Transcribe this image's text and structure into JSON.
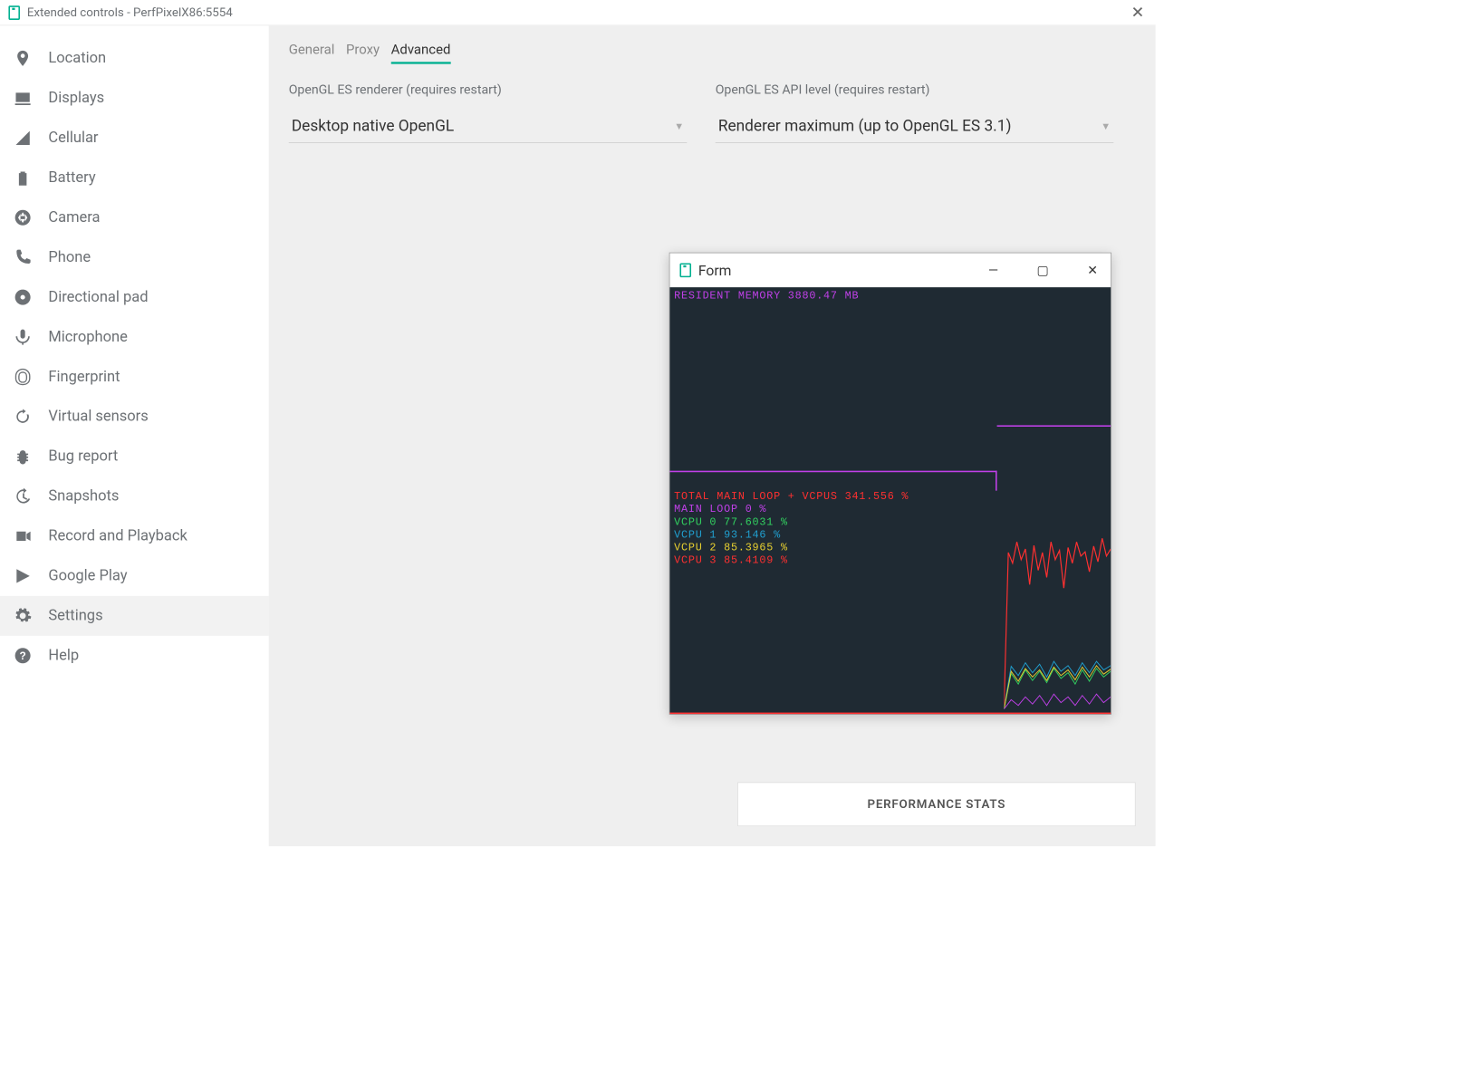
{
  "window": {
    "title": "Extended controls - PerfPixelX86:5554"
  },
  "sidebar": {
    "items": [
      {
        "id": "location",
        "label": "Location",
        "icon": "pin"
      },
      {
        "id": "displays",
        "label": "Displays",
        "icon": "display"
      },
      {
        "id": "cellular",
        "label": "Cellular",
        "icon": "signal"
      },
      {
        "id": "battery",
        "label": "Battery",
        "icon": "battery"
      },
      {
        "id": "camera",
        "label": "Camera",
        "icon": "aperture"
      },
      {
        "id": "phone",
        "label": "Phone",
        "icon": "phone"
      },
      {
        "id": "dpad",
        "label": "Directional pad",
        "icon": "dpad"
      },
      {
        "id": "microphone",
        "label": "Microphone",
        "icon": "mic"
      },
      {
        "id": "fingerprint",
        "label": "Fingerprint",
        "icon": "fingerprint"
      },
      {
        "id": "sensors",
        "label": "Virtual sensors",
        "icon": "rotate"
      },
      {
        "id": "bugreport",
        "label": "Bug report",
        "icon": "bug"
      },
      {
        "id": "snapshots",
        "label": "Snapshots",
        "icon": "history"
      },
      {
        "id": "record",
        "label": "Record and Playback",
        "icon": "video"
      },
      {
        "id": "play",
        "label": "Google Play",
        "icon": "play"
      },
      {
        "id": "settings",
        "label": "Settings",
        "icon": "gear",
        "active": true
      },
      {
        "id": "help",
        "label": "Help",
        "icon": "help"
      }
    ]
  },
  "tabs": {
    "items": [
      {
        "id": "general",
        "label": "General",
        "active": false
      },
      {
        "id": "proxy",
        "label": "Proxy",
        "active": false
      },
      {
        "id": "advanced",
        "label": "Advanced",
        "active": true
      }
    ]
  },
  "settings": {
    "renderer": {
      "label": "OpenGL ES renderer (requires restart)",
      "value": "Desktop native OpenGL"
    },
    "api_level": {
      "label": "OpenGL ES API level (requires restart)",
      "value": "Renderer maximum (up to OpenGL ES 3.1)"
    }
  },
  "perf_button": "PERFORMANCE STATS",
  "form": {
    "title": "Form",
    "memory": {
      "text": "RESIDENT MEMORY 3880.47 MB"
    },
    "cpu": {
      "total": "TOTAL MAIN LOOP + VCPUS 341.556 %",
      "mainloop": "MAIN LOOP 0 %",
      "v0": "VCPU 0 77.6031 %",
      "v1": "VCPU 1 93.146 %",
      "v2": "VCPU 2 85.3965 %",
      "v3": "VCPU 3 85.4109 %"
    }
  },
  "chart_data": [
    {
      "type": "line",
      "title": "Resident Memory",
      "ylabel": "MB",
      "current": 3880.47,
      "note": "stepped; only the live trace is visible (step up near right edge)"
    },
    {
      "type": "line",
      "title": "CPU Utilization",
      "ylabel": "%",
      "series": [
        {
          "name": "TOTAL MAIN LOOP + VCPUS",
          "current": 341.556,
          "color": "#ff3030"
        },
        {
          "name": "MAIN LOOP",
          "current": 0,
          "color": "#c040e8"
        },
        {
          "name": "VCPU 0",
          "current": 77.6031,
          "color": "#32d060"
        },
        {
          "name": "VCPU 1",
          "current": 93.146,
          "color": "#20a0d0"
        },
        {
          "name": "VCPU 2",
          "current": 85.3965,
          "color": "#e8d030"
        },
        {
          "name": "VCPU 3",
          "current": 85.4109,
          "color": "#ff3030"
        }
      ],
      "note": "only recent samples on the right side of the pane are drawn"
    }
  ]
}
